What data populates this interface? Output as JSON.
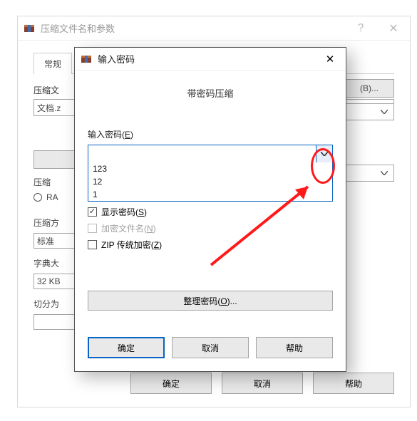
{
  "back_dialog": {
    "title": "压缩文件名和参数",
    "help_btn": "?",
    "close_btn": "✕",
    "tab_general": "常规",
    "archive_name_label": "压缩文",
    "archive_name_value": "文档.z",
    "browse_btn": "(B)...",
    "format_label": "压缩",
    "format_rar": "RA",
    "method_label": "压缩方",
    "method_value": "标准",
    "dict_label": "字典大",
    "dict_value": "32 KB",
    "split_label": "切分为",
    "ok": "确定",
    "cancel": "取消",
    "help": "帮助"
  },
  "front_dialog": {
    "title": "输入密码",
    "close_btn": "✕",
    "heading": "带密码压缩",
    "pw_label_prefix": "输入密码(",
    "pw_label_underlined": "E",
    "pw_label_suffix": ")",
    "pw_value": "",
    "dropdown_items": [
      "123",
      "12",
      "1"
    ],
    "chk_show_prefix": "显示密码(",
    "chk_show_underlined": "S",
    "chk_show_suffix": ")",
    "chk_encrypt_prefix": "加密文件名(",
    "chk_encrypt_underlined": "N",
    "chk_encrypt_suffix": ")",
    "chk_ziplegacy_prefix": "ZIP 传统加密(",
    "chk_ziplegacy_underlined": "Z",
    "chk_ziplegacy_suffix": ")",
    "organize_prefix": "整理密码(",
    "organize_underlined": "O",
    "organize_suffix": ")...",
    "ok": "确定",
    "cancel": "取消",
    "help": "帮助"
  }
}
